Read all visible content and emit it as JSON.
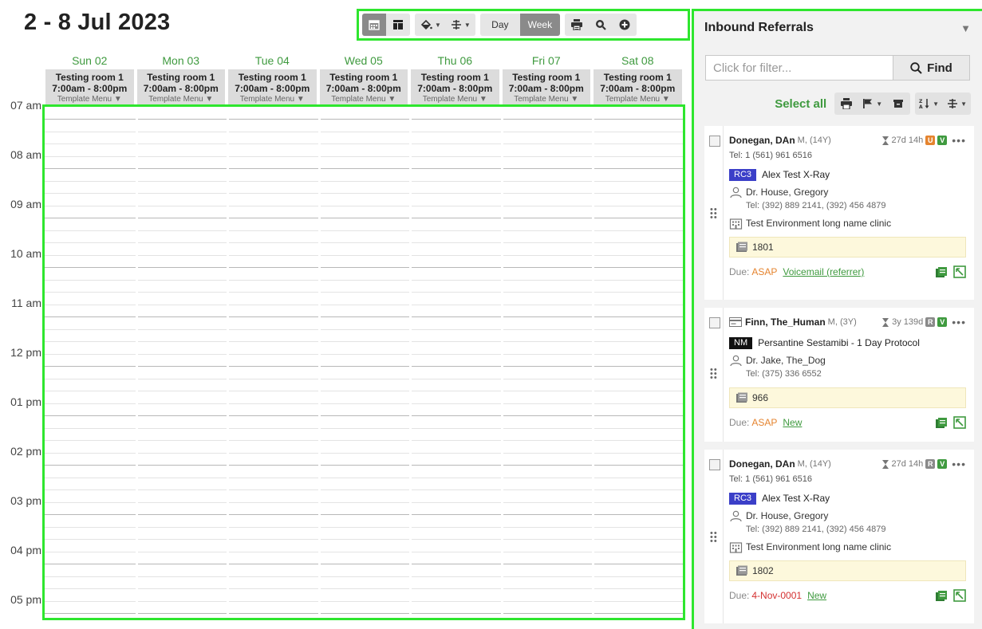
{
  "calendar": {
    "title": "2 - 8 Jul 2023",
    "view_day": "Day",
    "view_week": "Week",
    "days": [
      {
        "name": "Sun 02",
        "room": "Testing room 1",
        "hours": "7:00am - 8:00pm",
        "menu": "Template Menu ▼"
      },
      {
        "name": "Mon 03",
        "room": "Testing room 1",
        "hours": "7:00am - 8:00pm",
        "menu": "Template Menu ▼"
      },
      {
        "name": "Tue 04",
        "room": "Testing room 1",
        "hours": "7:00am - 8:00pm",
        "menu": "Template Menu ▼"
      },
      {
        "name": "Wed 05",
        "room": "Testing room 1",
        "hours": "7:00am - 8:00pm",
        "menu": "Template Menu ▼"
      },
      {
        "name": "Thu 06",
        "room": "Testing room 1",
        "hours": "7:00am - 8:00pm",
        "menu": "Template Menu ▼"
      },
      {
        "name": "Fri 07",
        "room": "Testing room 1",
        "hours": "7:00am - 8:00pm",
        "menu": "Template Menu ▼"
      },
      {
        "name": "Sat 08",
        "room": "Testing room 1",
        "hours": "7:00am - 8:00pm",
        "menu": "Template Menu ▼"
      }
    ],
    "hours": [
      "07 am",
      "08 am",
      "09 am",
      "10 am",
      "11 am",
      "12 pm",
      "01 pm",
      "02 pm",
      "03 pm",
      "04 pm",
      "05 pm"
    ],
    "accent_color": "#3f9a3f",
    "highlight_color": "#2ee62e"
  },
  "panel": {
    "title": "Inbound Referrals",
    "toggle": "▼",
    "filter_placeholder": "Click for filter...",
    "find_label": "Find",
    "select_all": "Select all"
  },
  "cards": [
    {
      "name": "Donegan, DAn",
      "demo": "M, (14Y)",
      "wait": "27d 14h",
      "badge1": "U",
      "badge1_color": "#e5842f",
      "badge2": "V",
      "tel": "Tel: 1 (561) 961 6516",
      "proc_code": "RC3",
      "proc_code_color": "#3b3fc8",
      "proc_name": "Alex Test X-Ray",
      "doctor": "Dr. House, Gregory",
      "doctor_tel": "Tel: (392) 889 2141, (392) 456 4879",
      "clinic": "Test Environment long name clinic",
      "ref_no": "1801",
      "due_label": "Due:",
      "due": "ASAP",
      "status": "Voicemail (referrer)"
    },
    {
      "name": "Finn, The_Human",
      "demo": "M, (3Y)",
      "wait": "3y 139d",
      "badge1": "R",
      "badge1_color": "#8a8a8a",
      "badge2": "V",
      "proc_code": "NM",
      "proc_code_color": "#111111",
      "proc_name": "Persantine Sestamibi - 1 Day Protocol",
      "doctor": "Dr. Jake, The_Dog",
      "doctor_tel": "Tel: (375) 336 6552",
      "ref_no": "966",
      "due_label": "Due:",
      "due": "ASAP",
      "status": "New"
    },
    {
      "name": "Donegan, DAn",
      "demo": "M, (14Y)",
      "wait": "27d 14h",
      "badge1": "R",
      "badge1_color": "#8a8a8a",
      "badge2": "V",
      "tel": "Tel: 1 (561) 961 6516",
      "proc_code": "RC3",
      "proc_code_color": "#3b3fc8",
      "proc_name": "Alex Test X-Ray",
      "doctor": "Dr. House, Gregory",
      "doctor_tel": "Tel: (392) 889 2141, (392) 456 4879",
      "clinic": "Test Environment long name clinic",
      "ref_no": "1802",
      "due_label": "Due:",
      "due": "4-Nov-0001",
      "status": "New"
    }
  ]
}
